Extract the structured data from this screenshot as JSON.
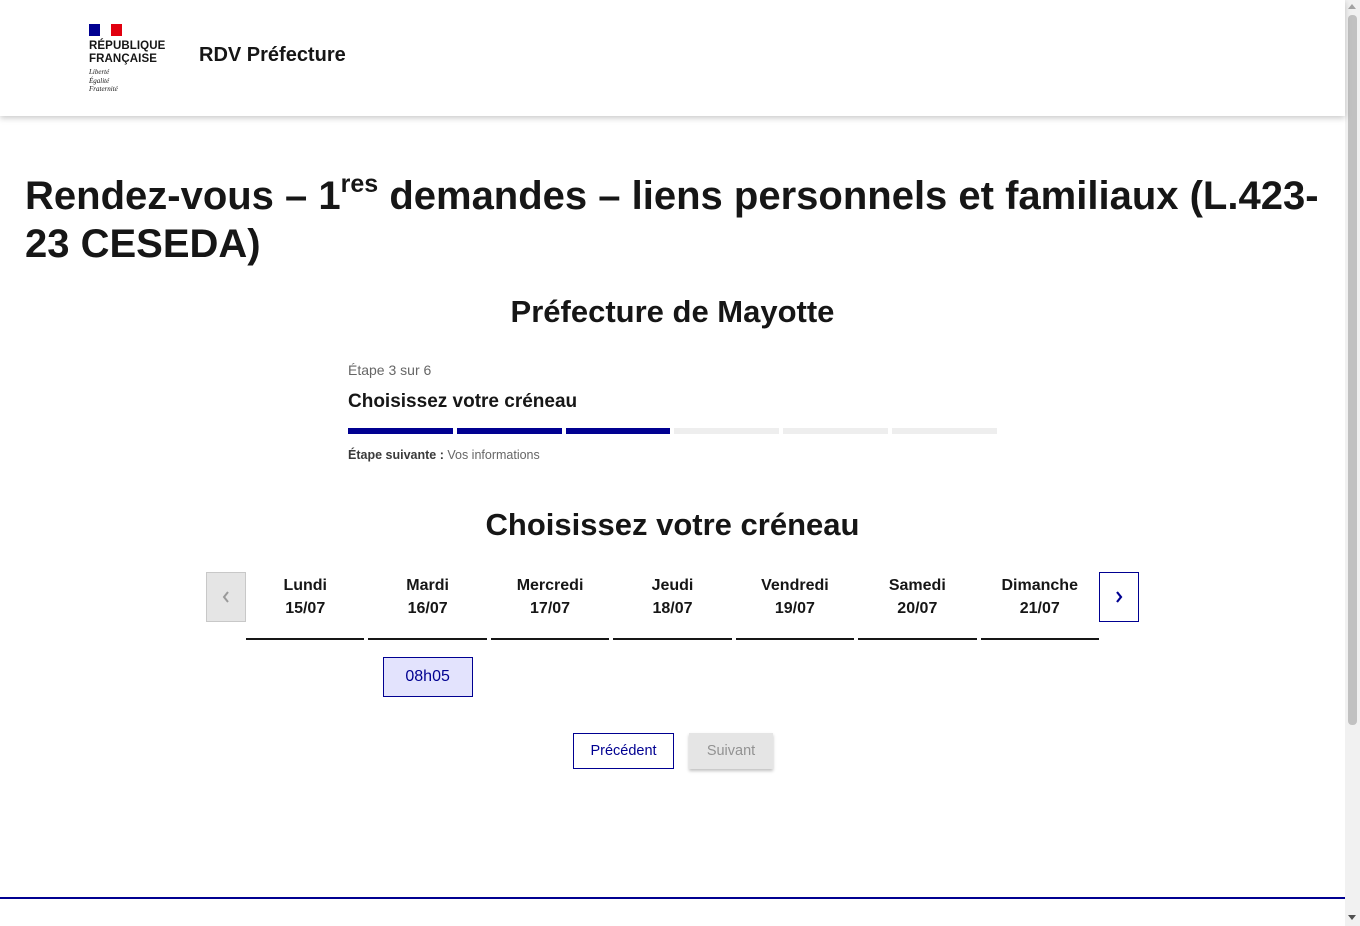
{
  "header": {
    "logo": {
      "line1": "RÉPUBLIQUE",
      "line2": "FRANÇAISE",
      "motto": [
        "Liberté",
        "Égalité",
        "Fraternité"
      ],
      "flag_colors": [
        "#000091",
        "#ffffff",
        "#e1000f"
      ]
    },
    "site_title": "RDV Préfecture"
  },
  "main": {
    "title_part1": "Rendez-vous – 1",
    "title_sup": "res",
    "title_part2": " demandes – liens personnels et familiaux (L.423-23 CESEDA)",
    "subtitle": "Préfecture de Mayotte"
  },
  "stepper": {
    "step_count": "Étape 3 sur 6",
    "step_title": "Choisissez votre créneau",
    "current_step": 3,
    "total_steps": 6,
    "next_label": "Étape suivante :",
    "next_value": " Vos informations"
  },
  "calendar": {
    "section_title": "Choisissez votre créneau",
    "prev_icon": "chevron-left-icon",
    "next_icon": "chevron-right-icon",
    "days": [
      {
        "name": "Lundi",
        "date": "15/07",
        "slots": []
      },
      {
        "name": "Mardi",
        "date": "16/07",
        "slots": [
          "08h05"
        ]
      },
      {
        "name": "Mercredi",
        "date": "17/07",
        "slots": []
      },
      {
        "name": "Jeudi",
        "date": "18/07",
        "slots": []
      },
      {
        "name": "Vendredi",
        "date": "19/07",
        "slots": []
      },
      {
        "name": "Samedi",
        "date": "20/07",
        "slots": []
      },
      {
        "name": "Dimanche",
        "date": "21/07",
        "slots": []
      }
    ]
  },
  "buttons": {
    "previous": "Précédent",
    "next": "Suivant"
  },
  "colors": {
    "primary": "#000091",
    "slot_background": "#e3e3fd",
    "disabled_background": "#e5e5e5",
    "disabled_text": "#929292"
  }
}
